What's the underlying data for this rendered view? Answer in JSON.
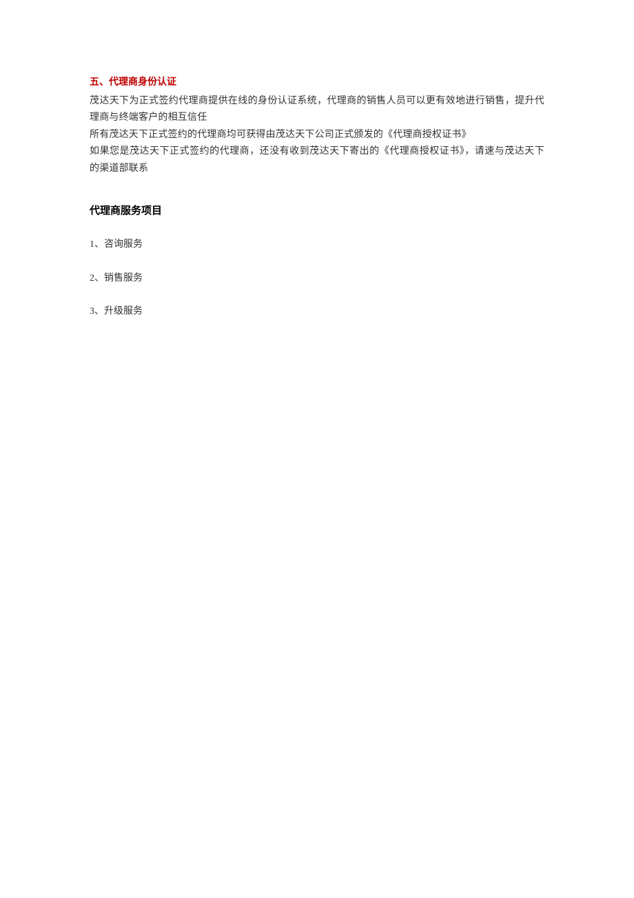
{
  "section_title": "五、代理商身份认证",
  "paragraphs": [
    "茂达天下为正式签约代理商提供在线的身份认证系统，代理商的销售人员可以更有效地进行销售，提升代理商与终端客户的相互信任",
    "所有茂达天下正式签约的代理商均可获得由茂达天下公司正式颁发的《代理商授权证书》",
    "如果您是茂达天下正式签约的代理商，还没有收到茂达天下寄出的《代理商授权证书》，请速与茂达天下的渠道部联系"
  ],
  "sub_heading": "代理商服务项目",
  "list": [
    "1、咨询服务",
    "2、销售服务",
    "3、升级服务"
  ]
}
